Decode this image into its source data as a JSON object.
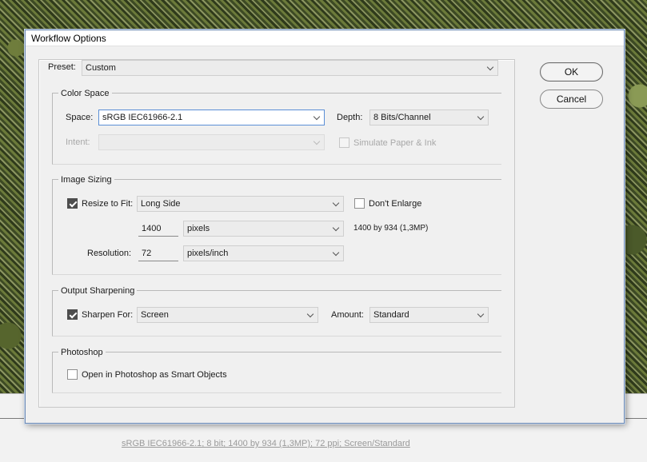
{
  "window": {
    "title": "Workflow Options"
  },
  "preset": {
    "label": "Preset:",
    "value": "Custom"
  },
  "buttons": {
    "ok": "OK",
    "cancel": "Cancel"
  },
  "color_space": {
    "title": "Color Space",
    "space_label": "Space:",
    "space_value": "sRGB IEC61966-2.1",
    "depth_label": "Depth:",
    "depth_value": "8 Bits/Channel",
    "intent_label": "Intent:",
    "intent_value": "",
    "simulate_label": "Simulate Paper & Ink",
    "simulate_checked": false
  },
  "image_sizing": {
    "title": "Image Sizing",
    "resize_label": "Resize to Fit:",
    "resize_checked": true,
    "resize_value": "Long Side",
    "dont_enlarge_label": "Don't Enlarge",
    "dont_enlarge_checked": false,
    "size_value": "1400",
    "size_unit": "pixels",
    "size_info": "1400 by 934 (1,3MP)",
    "resolution_label": "Resolution:",
    "resolution_value": "72",
    "resolution_unit": "pixels/inch"
  },
  "output_sharpening": {
    "title": "Output Sharpening",
    "sharpen_label": "Sharpen For:",
    "sharpen_checked": true,
    "sharpen_value": "Screen",
    "amount_label": "Amount:",
    "amount_value": "Standard"
  },
  "photoshop": {
    "title": "Photoshop",
    "smart_objects_label": "Open in Photoshop as Smart Objects",
    "smart_objects_checked": false
  },
  "status_bar": {
    "summary": "sRGB IEC61966-2.1; 8 bit; 1400 by 934 (1,3MP); 72 ppi; Screen/Standard"
  }
}
